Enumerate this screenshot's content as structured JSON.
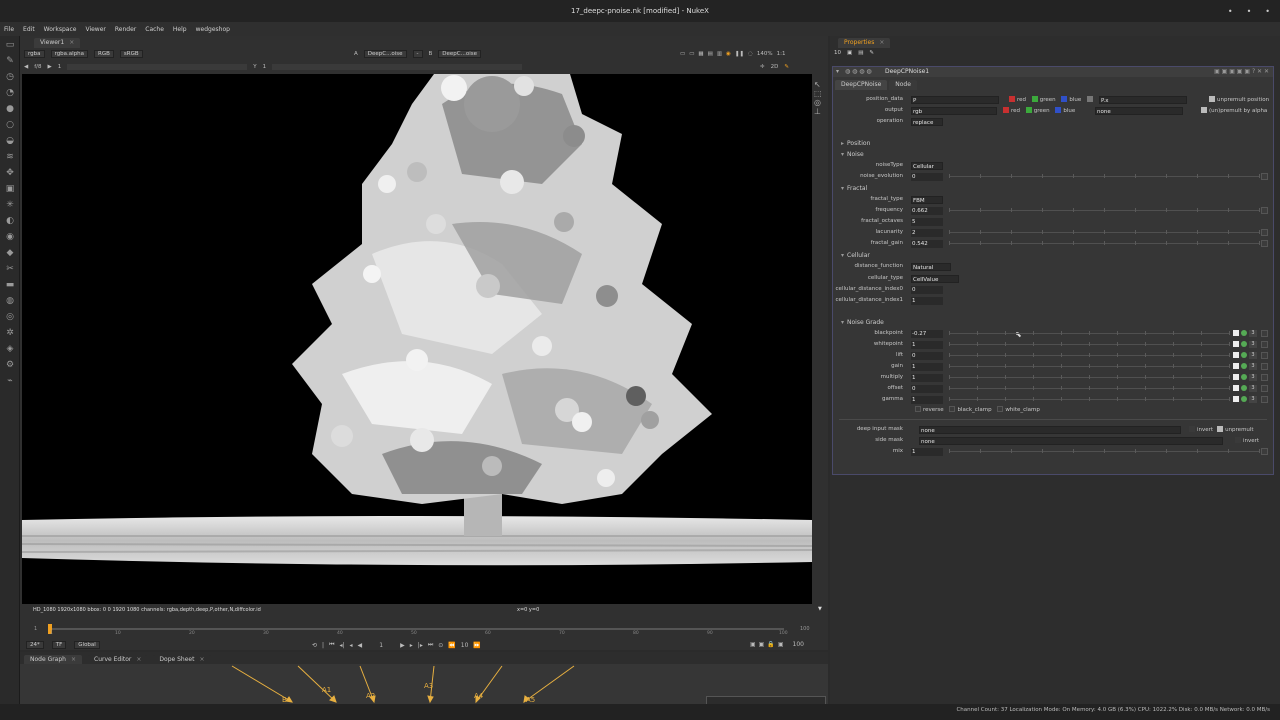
{
  "window": {
    "title": "17_deepc-pnoise.nk [modified] - NukeX"
  },
  "menu": [
    "File",
    "Edit",
    "Workspace",
    "Viewer",
    "Render",
    "Cache",
    "Help",
    "wedgeshop"
  ],
  "viewer": {
    "tab_label": "Viewer1",
    "channels": "rgba",
    "alpha": "rgba.alpha",
    "colorspace_mode": "RGB",
    "lut": "sRGB",
    "input_a_label": "A",
    "input_a": "DeepC...oise",
    "input_a_sep": "-",
    "input_b_label": "B",
    "input_b": "DeepC...oise",
    "frame_step": "f/8",
    "frame_field": "1",
    "y_label": "Y",
    "y_value": "1",
    "zoom": "140%",
    "ratio": "1:1",
    "view_mode": "2D",
    "info_left": "HD_1080 1920x1080  bbox: 0 0 1920 1080 channels: rgba,depth,deep,P,other,N,diffcolor.id",
    "info_right": "x=0 y=0"
  },
  "timeline": {
    "start": "1",
    "end": "100",
    "ticks": [
      "1",
      "10",
      "20",
      "30",
      "40",
      "50",
      "60",
      "70",
      "80",
      "90",
      "100"
    ],
    "fps": "24*",
    "tf": "TF",
    "scope": "Global",
    "current_frame": "1",
    "step": "10",
    "end_field": "100"
  },
  "bottom_tabs": [
    "Node Graph",
    "Curve Editor",
    "Dope Sheet"
  ],
  "graph_labels": [
    "B",
    "A1",
    "A2",
    "A3",
    "A4",
    "A5"
  ],
  "properties": {
    "tab_label": "Properties",
    "count_field": "10",
    "node_name": "DeepCPNoise1",
    "subtabs": [
      "DeepCPNoise",
      "Node"
    ],
    "position_data": {
      "label": "position_data",
      "value": "P",
      "ch": [
        "red",
        "green",
        "blue"
      ],
      "mask": "P.x",
      "unpremult": "unpremult position"
    },
    "output": {
      "label": "output",
      "value": "rgb",
      "ch": [
        "red",
        "green",
        "blue"
      ],
      "mask": "none",
      "unpremult": "(un)premult by alpha"
    },
    "operation": {
      "label": "operation",
      "value": "replace"
    },
    "sections": {
      "position": "Position",
      "noise": "Noise",
      "fractal": "Fractal",
      "cellular": "Cellular",
      "grade": "Noise Grade"
    },
    "noiseType": {
      "label": "noiseType",
      "value": "Cellular"
    },
    "noise_evolution": {
      "label": "noise_evolution",
      "value": "0"
    },
    "fractal_type": {
      "label": "fractal_type",
      "value": "FBM"
    },
    "frequency": {
      "label": "frequency",
      "value": "0.662"
    },
    "fractal_octaves": {
      "label": "fractal_octaves",
      "value": "5"
    },
    "lacunarity": {
      "label": "lacunarity",
      "value": "2"
    },
    "fractal_gain": {
      "label": "fractal_gain",
      "value": "0.542"
    },
    "distance_function": {
      "label": "distance_function",
      "value": "Natural"
    },
    "cellular_type": {
      "label": "cellular_type",
      "value": "CellValue"
    },
    "cdi0": {
      "label": "cellular_distance_index0",
      "value": "0"
    },
    "cdi1": {
      "label": "cellular_distance_index1",
      "value": "1"
    },
    "grade": [
      {
        "label": "blackpoint",
        "value": "-0.27"
      },
      {
        "label": "whitepoint",
        "value": "1"
      },
      {
        "label": "lift",
        "value": "0"
      },
      {
        "label": "gain",
        "value": "1"
      },
      {
        "label": "multiply",
        "value": "1"
      },
      {
        "label": "offset",
        "value": "0"
      },
      {
        "label": "gamma",
        "value": "1"
      }
    ],
    "grade_checks": [
      "reverse",
      "black_clamp",
      "white_clamp"
    ],
    "deep_input_mask": {
      "label": "deep input mask",
      "value": "none",
      "invert": "invert",
      "unpremult": "unpremult"
    },
    "side_mask": {
      "label": "side mask",
      "value": "none",
      "invert": "invert"
    },
    "mix": {
      "label": "mix",
      "value": "1"
    }
  },
  "status": "Channel Count: 37  Localization Mode: On  Memory: 4.0 GB (6.3%) CPU: 1022.2% Disk: 0.0 MB/s Network: 0.0 MB/s",
  "colors": {
    "accent": "#f0a020",
    "red_chk": "#c83030",
    "green_chk": "#3caa3c",
    "blue_chk": "#3050c8",
    "panel_border": "#4a4a6a"
  }
}
